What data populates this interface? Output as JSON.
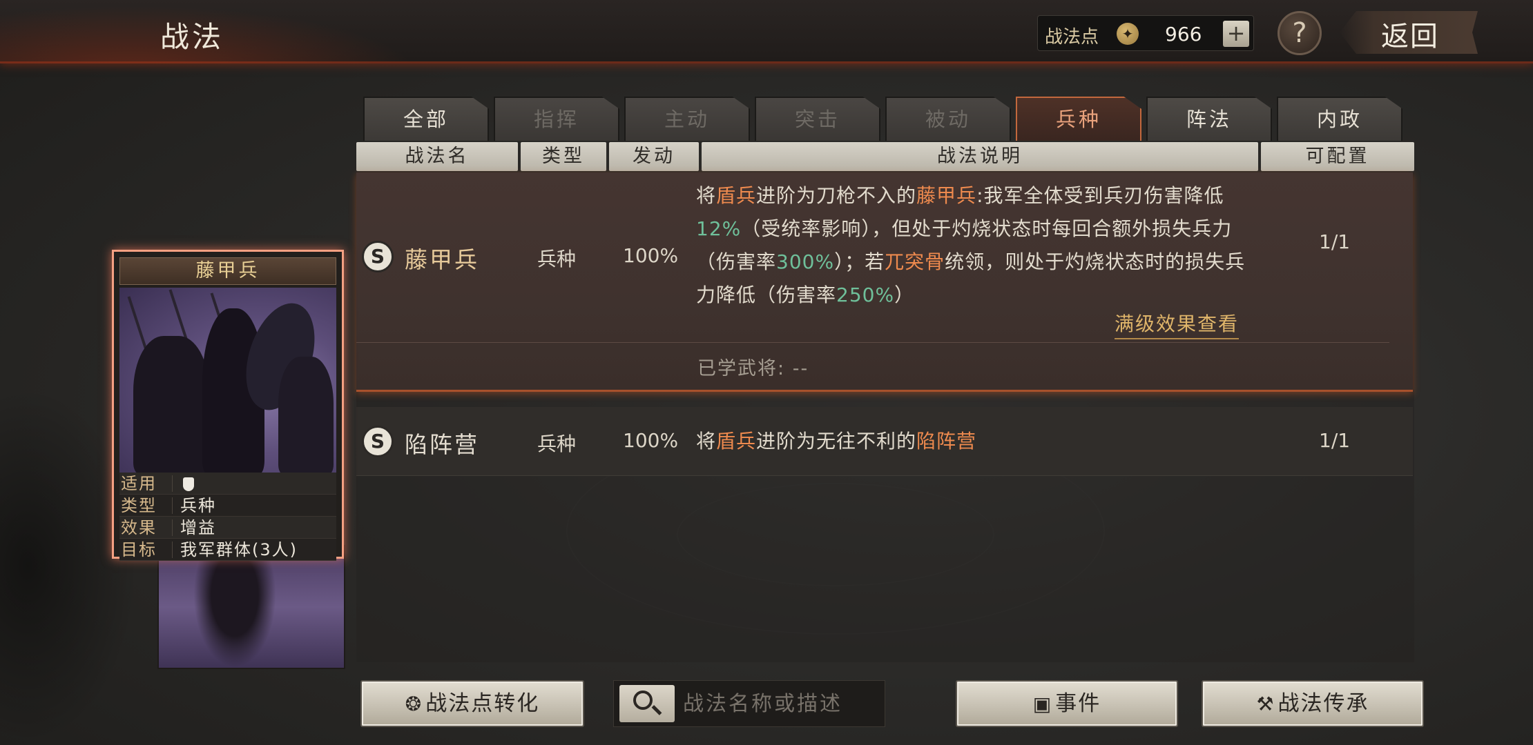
{
  "header": {
    "title": "战法",
    "points_label": "战法点",
    "points_value": "966",
    "plus_label": "+",
    "help_label": "?",
    "back_label": "返回"
  },
  "tabs": [
    {
      "label": "全部",
      "state": "enabled"
    },
    {
      "label": "指挥",
      "state": "disabled"
    },
    {
      "label": "主动",
      "state": "disabled"
    },
    {
      "label": "突击",
      "state": "disabled"
    },
    {
      "label": "被动",
      "state": "disabled"
    },
    {
      "label": "兵种",
      "state": "active"
    },
    {
      "label": "阵法",
      "state": "enabled"
    },
    {
      "label": "内政",
      "state": "enabled"
    }
  ],
  "columns": {
    "name": "战法名",
    "type": "类型",
    "rate": "发动",
    "desc": "战法说明",
    "config": "可配置"
  },
  "rows": [
    {
      "grade": "S",
      "name": "藤甲兵",
      "type": "兵种",
      "rate": "100%",
      "config": "1/1",
      "desc_parts": [
        "将",
        "盾兵",
        "进阶为刀枪不入的",
        "藤甲兵",
        ":我军全体受到兵刃伤害降低",
        "12%",
        "（受统率影响），但处于灼烧状态时每回合额外损失兵力（伤害率",
        "300%",
        "）；若",
        "兀突骨",
        "统领，则处于灼烧状态时的损失兵力降低（伤害率",
        "250%",
        "）"
      ],
      "more_link": "满级效果查看",
      "learned_label": "已学武将:",
      "learned_value": "--"
    },
    {
      "grade": "S",
      "name": "陷阵营",
      "type": "兵种",
      "rate": "100%",
      "config": "1/1",
      "desc_parts": [
        "将",
        "盾兵",
        "进阶为无往不利的",
        "陷阵营"
      ]
    }
  ],
  "card": {
    "title": "藤甲兵",
    "info": [
      {
        "key": "适用",
        "value": ""
      },
      {
        "key": "类型",
        "value": "兵种"
      },
      {
        "key": "效果",
        "value": "增益"
      },
      {
        "key": "目标",
        "value": "我军群体(3人)"
      }
    ]
  },
  "footer": {
    "convert_label": "战法点转化",
    "search_placeholder": "战法名称或描述",
    "event_label": "事件",
    "inherit_label": "战法传承"
  },
  "colors": {
    "accent_orange": "#ee8a4e",
    "accent_green": "#6fc09a",
    "active_tab_border": "#c3683d",
    "card_glow": "#f4a082"
  }
}
